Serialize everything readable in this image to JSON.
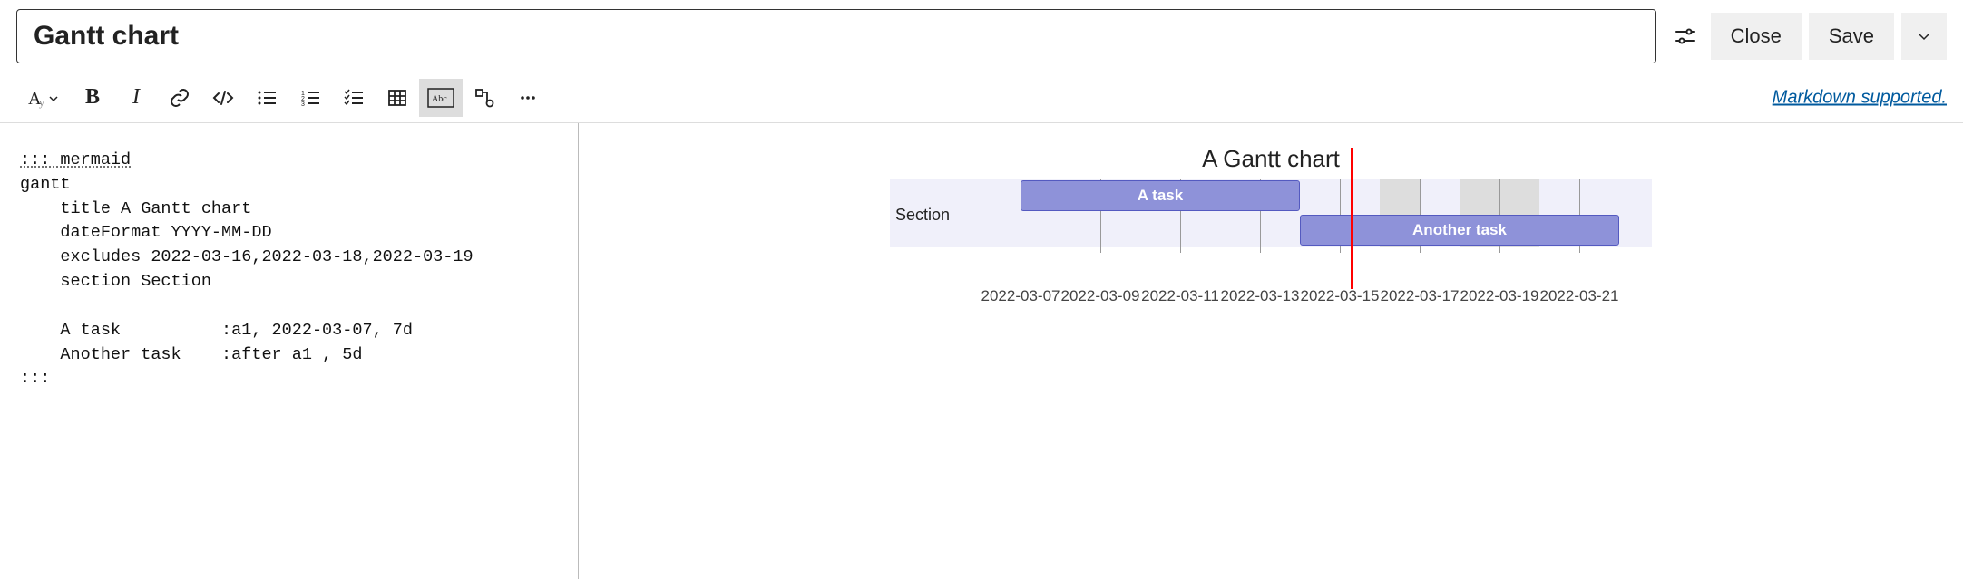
{
  "header": {
    "title_value": "Gantt chart",
    "close_label": "Close",
    "save_label": "Save"
  },
  "toolbar": {
    "markdown_link": "Markdown supported."
  },
  "editor": {
    "opener": "::: mermaid",
    "l1": "gantt",
    "l2": "    title A Gantt chart",
    "l3": "    dateFormat YYYY-MM-DD",
    "l4": "    excludes 2022-03-16,2022-03-18,2022-03-19",
    "l5": "    section Section",
    "l6": "",
    "l7": "    A task          :a1, 2022-03-07, 7d",
    "l8": "    Another task    :after a1 , 5d",
    "closer": ":::"
  },
  "preview": {
    "title": "A Gantt chart",
    "section_label": "Section",
    "task1_label": "A task",
    "task2_label": "Another task",
    "ticks": {
      "t0": "2022-03-07",
      "t1": "2022-03-09",
      "t2": "2022-03-11",
      "t3": "2022-03-13",
      "t4": "2022-03-15",
      "t5": "2022-03-17",
      "t6": "2022-03-19",
      "t7": "2022-03-21"
    }
  },
  "chart_data": {
    "type": "gantt",
    "title": "A Gantt chart",
    "date_format": "YYYY-MM-DD",
    "excludes": [
      "2022-03-16",
      "2022-03-18",
      "2022-03-19"
    ],
    "today": "2022-03-15",
    "sections": [
      {
        "name": "Section",
        "tasks": [
          {
            "id": "a1",
            "name": "A task",
            "start": "2022-03-07",
            "duration_days": 7,
            "end": "2022-03-14"
          },
          {
            "id": "a2",
            "name": "Another task",
            "start": "2022-03-14",
            "duration_days": 5,
            "end": "2022-03-22",
            "after": "a1"
          }
        ]
      }
    ],
    "axis_ticks": [
      "2022-03-07",
      "2022-03-09",
      "2022-03-11",
      "2022-03-13",
      "2022-03-15",
      "2022-03-17",
      "2022-03-19",
      "2022-03-21"
    ],
    "x_range": [
      "2022-03-06",
      "2022-03-23"
    ]
  }
}
